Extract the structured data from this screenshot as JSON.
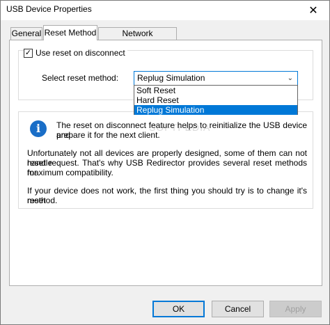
{
  "window": {
    "title": "USB Device Properties",
    "close_glyph": "✕"
  },
  "tabs": [
    {
      "label": "General",
      "active": false
    },
    {
      "label": "Reset Method",
      "active": true
    },
    {
      "label": "Network Compression",
      "active": false
    }
  ],
  "reset": {
    "checkbox_label": "Use reset on disconnect",
    "checked": true,
    "check_glyph": "✓",
    "select_label": "Select reset method:",
    "selected_value": "Replug Simulation",
    "options": [
      "Soft Reset",
      "Hard Reset",
      "Replug Simulation"
    ]
  },
  "info": {
    "icon_glyph": "i",
    "paragraph1": [
      "The reset on disconnect feature helps to reinitialize the USB device and",
      "prepare it for the next client."
    ],
    "paragraph2": [
      "Unfortunately not all devices are properly designed, some of them can not handle",
      "reset request. That's why USB Redirector provides several reset methods for",
      "maximum compatibility."
    ],
    "paragraph3": [
      "If your device does not work, the first thing you should try is to change it's reset",
      "method."
    ]
  },
  "buttons": {
    "ok": "OK",
    "cancel": "Cancel",
    "apply": "Apply"
  },
  "watermark": "SOFTPEDIA",
  "colors": {
    "accent": "#0078d7",
    "info_icon": "#1a6ec7"
  }
}
